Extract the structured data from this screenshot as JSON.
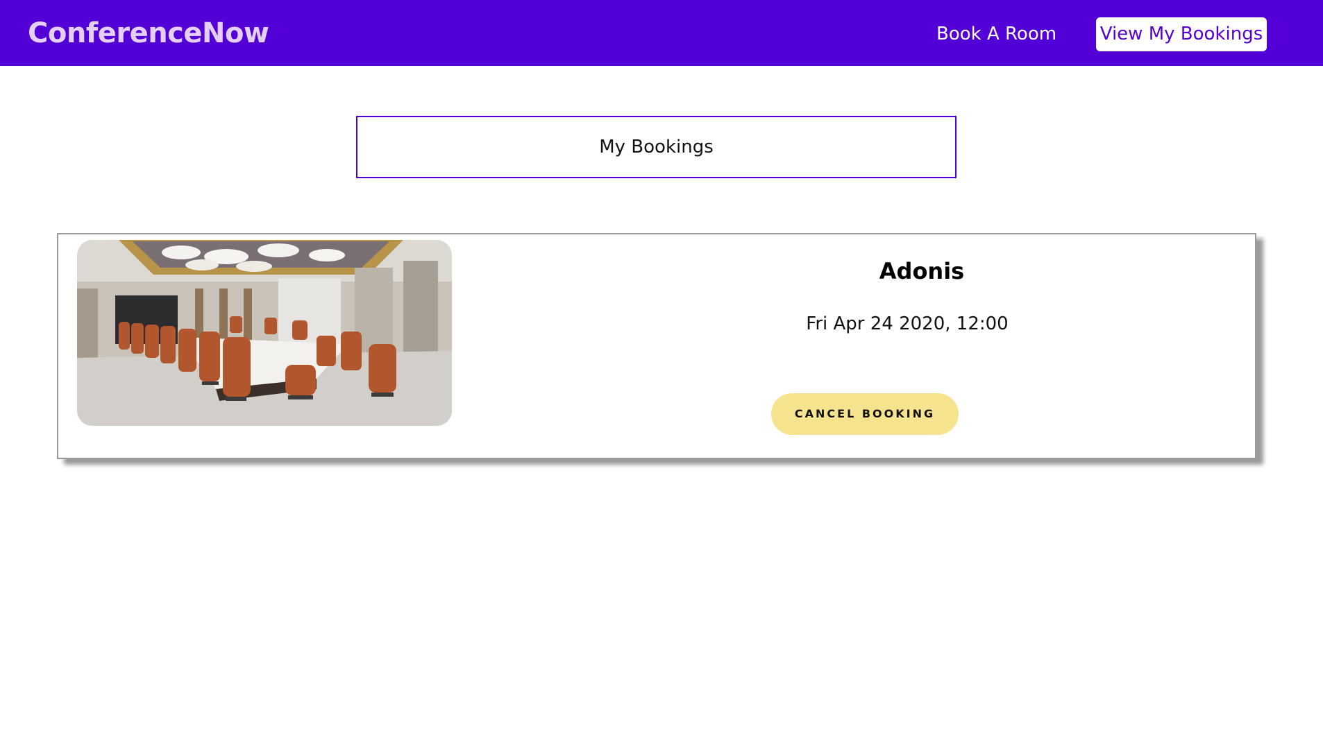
{
  "nav": {
    "brand": "ConferenceNow",
    "links": [
      {
        "label": "Book A Room"
      },
      {
        "label": "View My Bookings",
        "active": true
      }
    ],
    "background_color": "#5300d6",
    "brand_color": "#e4cff8"
  },
  "page": {
    "title": "My Bookings"
  },
  "bookings": [
    {
      "room_name": "Adonis",
      "datetime": "Fri Apr 24 2020, 12:00",
      "cancel_label": "CANCEL BOOKING",
      "button_color": "#f5e38d"
    }
  ]
}
